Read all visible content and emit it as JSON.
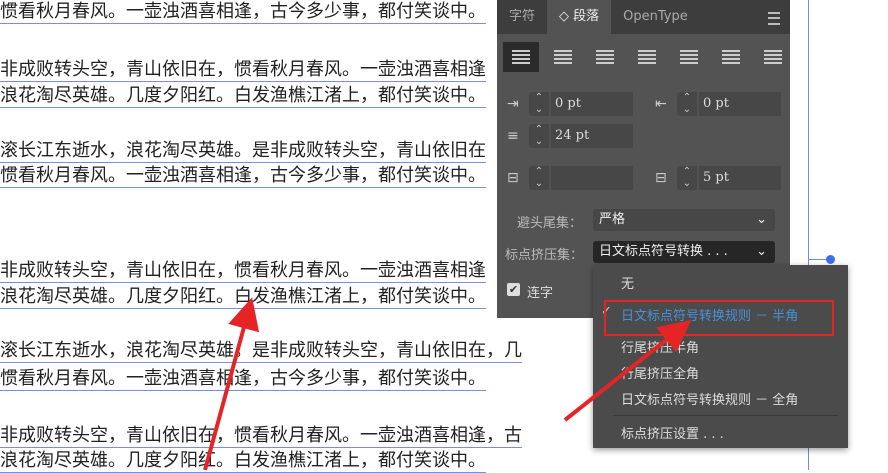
{
  "document": {
    "lines": [
      "惯看秋月春风。一壶浊酒喜相逢，古今多少事，都付笑谈中。",
      "非成败转头空，青山依旧在，惯看秋月春风。一壶浊酒喜相逢",
      "浪花淘尽英雄。几度夕阳红。白发渔樵江渚上，都付笑谈中。",
      "滚长江东逝水，浪花淘尽英雄。是非成败转头空，青山依旧在",
      "惯看秋月春风。一壶浊酒喜相逢，古今多少事，都付笑谈中。",
      "非成败转头空，青山依旧在，惯看秋月春风。一壶浊酒喜相逢",
      "浪花淘尽英雄。几度夕阳红。白发渔樵江渚上，都付笑谈中。",
      "滚长江东逝水，浪花淘尽英雄。是非成败转头空，青山依旧在，几",
      "惯看秋月春风。一壶浊酒喜相逢，古今多少事，都付笑谈中。",
      "非成败转头空，青山依旧在，惯看秋月春风。一壶浊酒喜相逢，古",
      "浪花淘尽英雄。几度夕阳红。白发渔樵江渚上，都付笑谈中。"
    ]
  },
  "panel": {
    "tabs": [
      "字符",
      "◇ 段落",
      "OpenType"
    ],
    "left_indent": "0 pt",
    "right_indent": "0 pt",
    "first_line_indent": "24 pt",
    "space_before": "",
    "space_after": "5 pt",
    "kinsoku_label": "避头尾集：",
    "kinsoku_value": "严格",
    "mojikumi_label": "标点挤压集：",
    "mojikumi_value": "日文标点符号转换 . . .",
    "hyphenate_label": "连字"
  },
  "dropdown": {
    "items": [
      "无",
      "日文标点符号转换规则 － 半角",
      "行尾挤压半角",
      "行尾挤压全角",
      "日文标点符号转换规则 － 全角",
      "标点挤压设置 . . ."
    ],
    "selected_index": 1
  },
  "colors": {
    "highlight": "#e52525",
    "selected_text": "#4a90d9"
  }
}
